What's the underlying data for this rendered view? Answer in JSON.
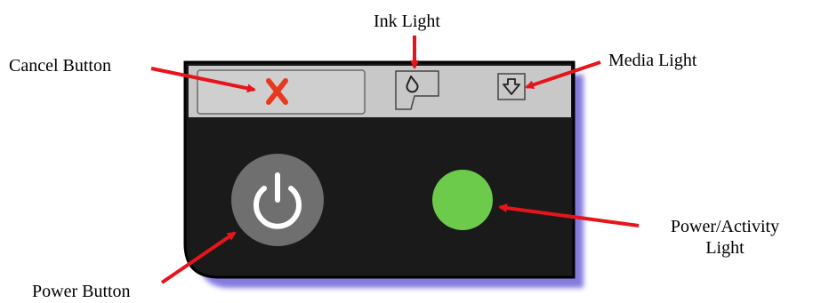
{
  "labels": {
    "ink_light": "Ink Light",
    "cancel_button": "Cancel Button",
    "media_light": "Media Light",
    "power_activity_line1": "Power/Activity",
    "power_activity_line2": "Light",
    "power_button": "Power Button"
  },
  "colors": {
    "arrow": "#e8141b",
    "panel_top": "#c8c8c8",
    "panel_body": "#1a1a1a",
    "panel_glow": "#6e63d8",
    "cancel_x": "#e8391f",
    "power_button": "#6f6f6f",
    "power_symbol": "#ffffff",
    "activity_light": "#6ccb4a"
  },
  "icons": {
    "cancel": "x-icon",
    "ink": "ink-drop-icon",
    "media": "media-arrow-icon",
    "power": "power-icon",
    "activity": "status-light-icon"
  }
}
